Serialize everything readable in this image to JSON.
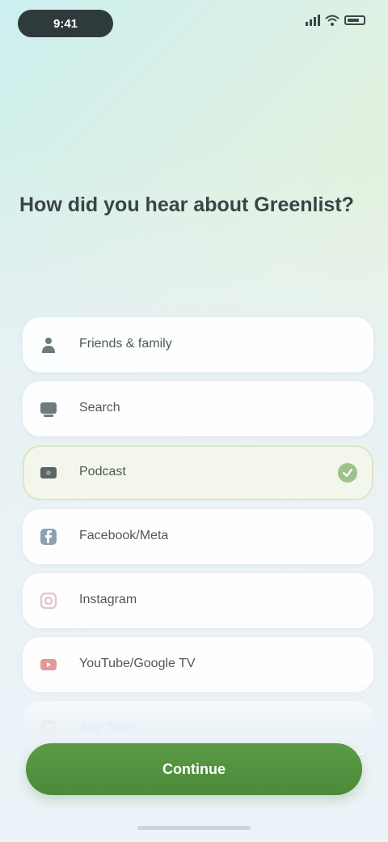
{
  "status_bar": {
    "time": "9:41",
    "subtitle": ""
  },
  "question": {
    "text": "How did you hear about Greenlist?"
  },
  "options": [
    {
      "label": "Friends & family",
      "icon": "people-icon",
      "color": "#6f7a7c",
      "selected": false
    },
    {
      "label": "Search",
      "icon": "search-icon",
      "color": "#6f7a7c",
      "selected": false
    },
    {
      "label": "Podcast",
      "icon": "mic-icon",
      "color": "#5b6567",
      "selected": true
    },
    {
      "label": "Facebook/Meta",
      "icon": "facebook-icon",
      "color": "#8da0b1",
      "selected": false
    },
    {
      "label": "Instagram",
      "icon": "instagram-icon",
      "color": "#e6c3d4",
      "selected": false
    },
    {
      "label": "YouTube/Google TV",
      "icon": "youtube-icon",
      "color": "#e29a9a",
      "selected": false
    },
    {
      "label": "App Store",
      "icon": "appstore-icon",
      "color": "#c4927a",
      "selected": false
    }
  ],
  "cta": {
    "label": "Continue"
  },
  "colors": {
    "accent": "#4f8f3c",
    "check": "#9fc28d"
  }
}
